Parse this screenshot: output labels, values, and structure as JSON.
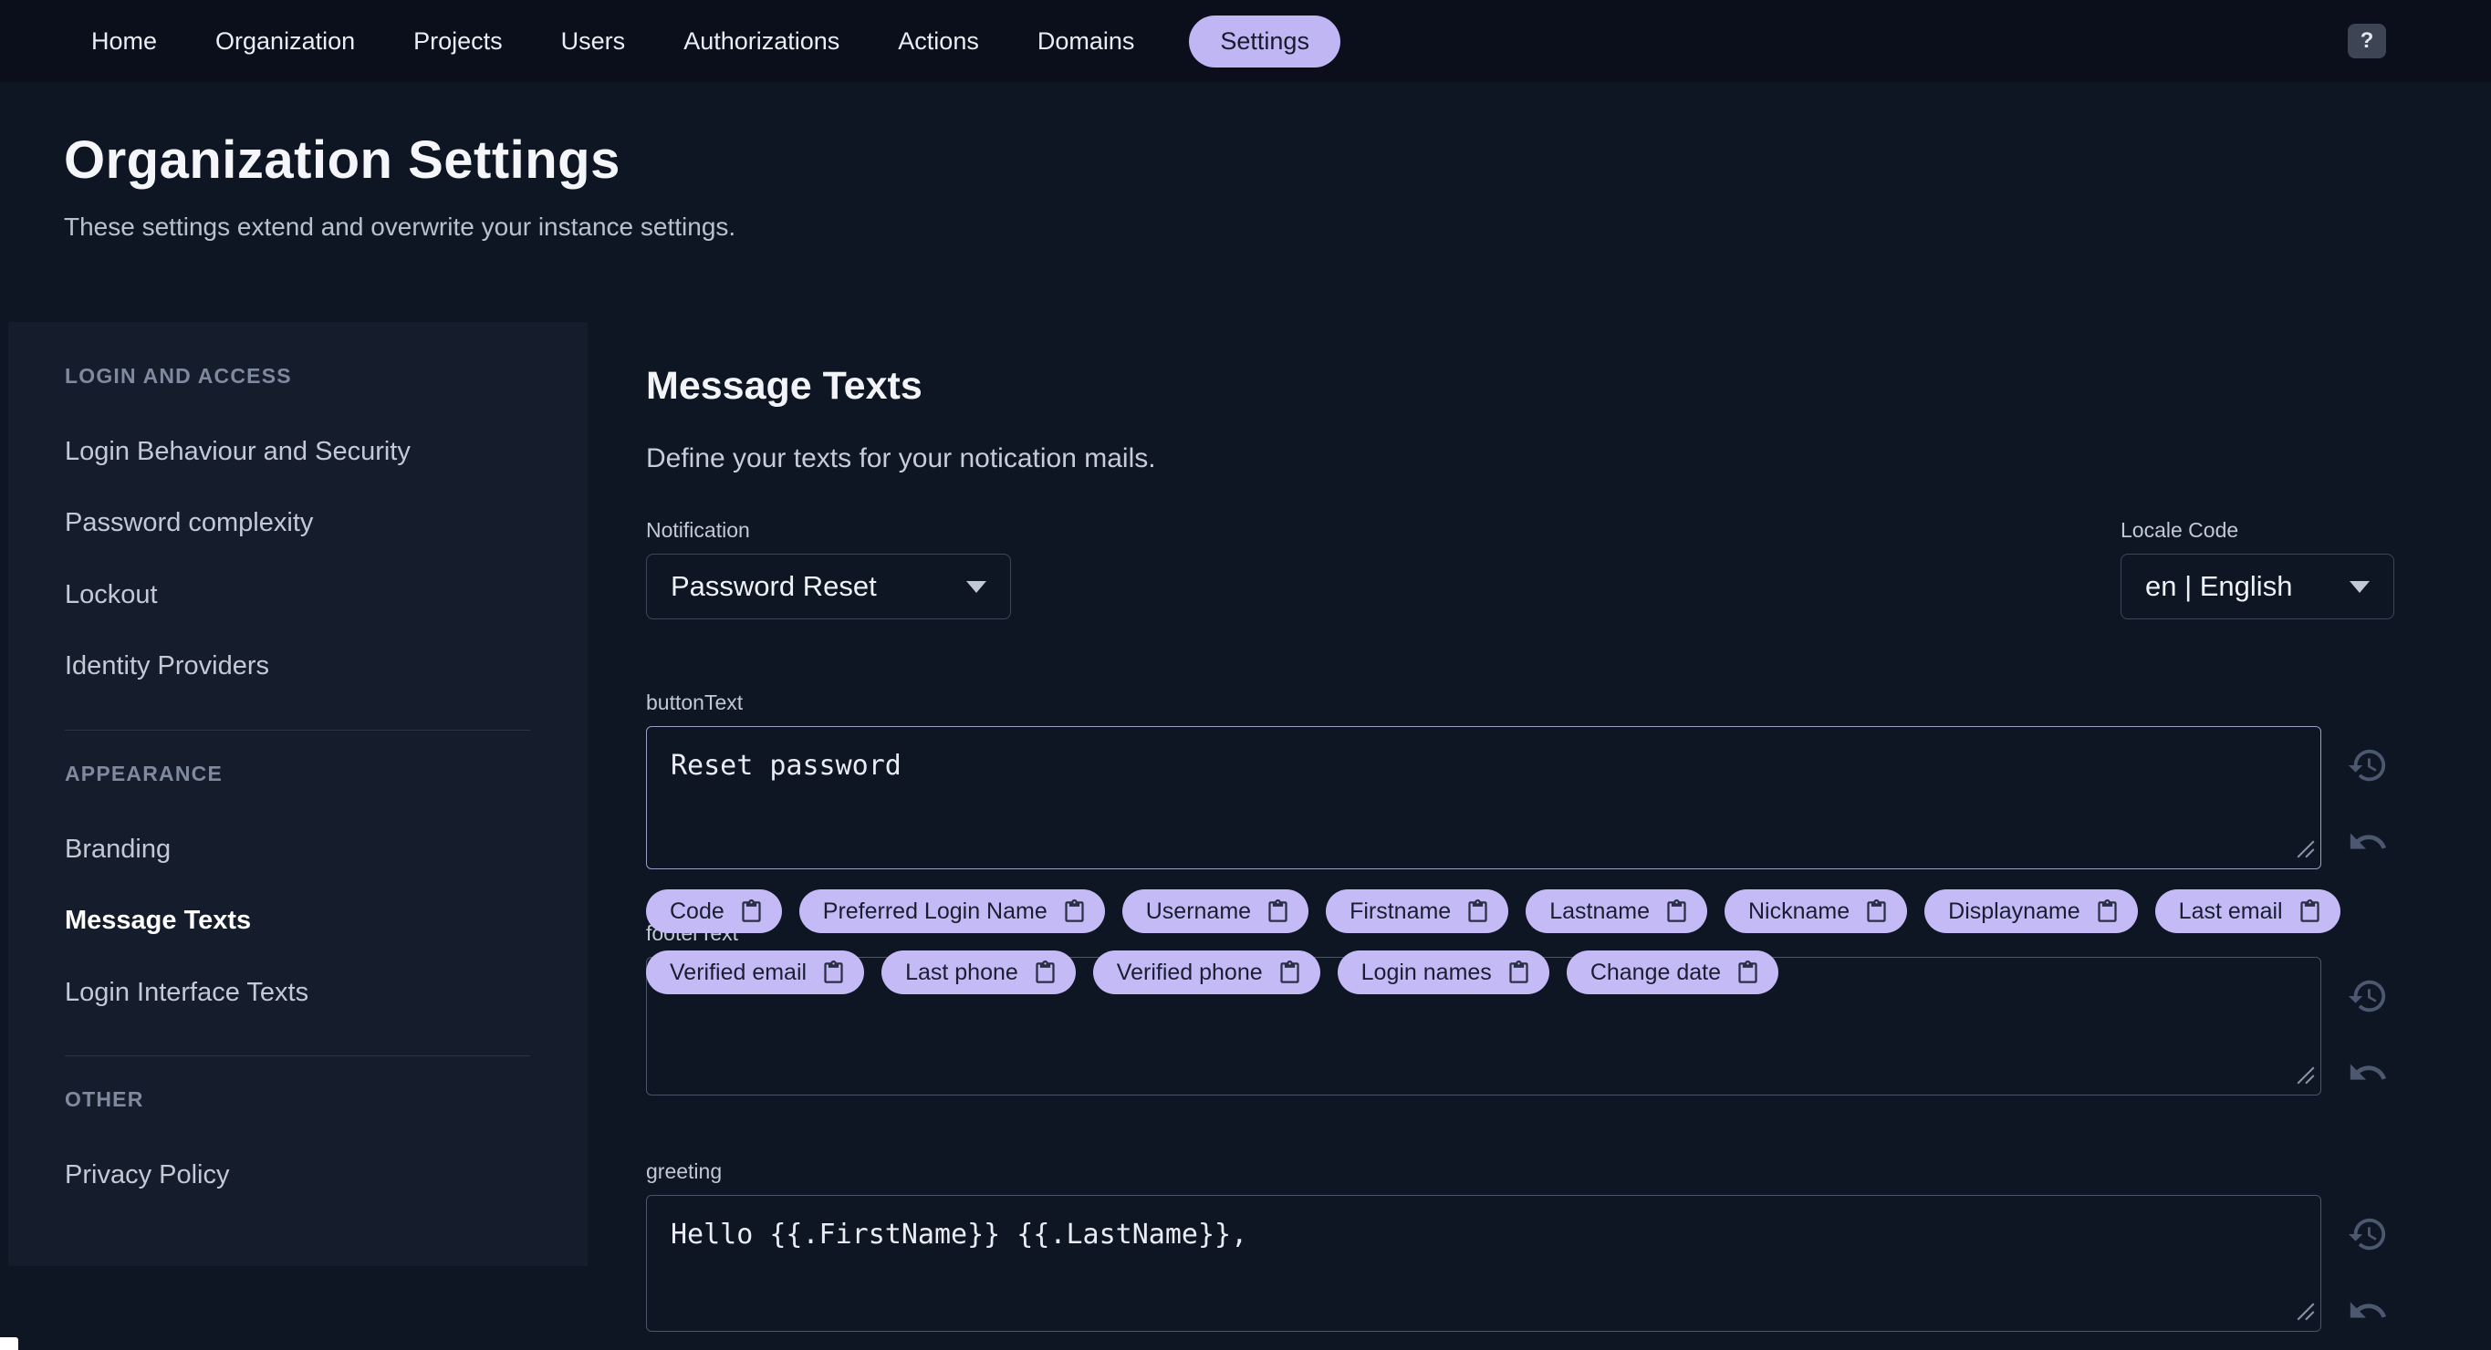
{
  "colors": {
    "accent": "#c0b6f3",
    "background": "#0e1624",
    "navbar": "#0a0f1b",
    "sidebar": "#151d2c"
  },
  "navbar": {
    "items": [
      "Home",
      "Organization",
      "Projects",
      "Users",
      "Authorizations",
      "Actions",
      "Domains",
      "Settings"
    ],
    "active_item": "Settings",
    "help": "?"
  },
  "header": {
    "title": "Organization Settings",
    "subtitle": "These settings extend and overwrite your instance settings."
  },
  "sidebar": {
    "sections": [
      {
        "title": "LOGIN AND ACCESS",
        "items": [
          "Login Behaviour and Security",
          "Password complexity",
          "Lockout",
          "Identity Providers"
        ]
      },
      {
        "title": "APPEARANCE",
        "items": [
          "Branding",
          "Message Texts",
          "Login Interface Texts"
        ]
      },
      {
        "title": "OTHER",
        "items": [
          "Privacy Policy"
        ]
      }
    ],
    "active_item": "Message Texts"
  },
  "main": {
    "title": "Message Texts",
    "subtitle": "Define your texts for your notication mails.",
    "notification": {
      "label": "Notification",
      "value": "Password Reset"
    },
    "locale": {
      "label": "Locale Code",
      "value": "en | English"
    },
    "fields": {
      "buttonText": {
        "label": "buttonText",
        "value": "Reset password"
      },
      "footerText": {
        "label": "footerText",
        "value": ""
      },
      "greeting": {
        "label": "greeting",
        "value": "Hello {{.FirstName}} {{.LastName}},"
      }
    },
    "chips_row1": [
      "Code",
      "Preferred Login Name",
      "Username",
      "Firstname",
      "Lastname",
      "Nickname",
      "Displayname",
      "Last email"
    ],
    "chips_row2": [
      "Verified email",
      "Last phone",
      "Verified phone",
      "Login names",
      "Change date"
    ]
  }
}
